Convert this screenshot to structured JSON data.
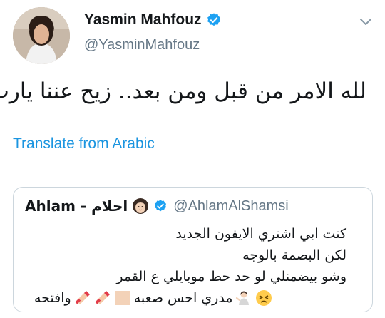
{
  "tweet": {
    "author": {
      "display_name": "Yasmin Mahfouz",
      "handle": "@YasminMahfouz",
      "verified": true,
      "avatar_icon": "profile-photo"
    },
    "text": "لله الامر من قبل ومن بعد.. زيح عننا يارب",
    "translate_label": "Translate from Arabic",
    "menu_icon": "chevron-down-icon"
  },
  "quoted_tweet": {
    "display_name": "Ahlam - احلام",
    "handle": "@AhlamAlShamsi",
    "verified": true,
    "lines": [
      "كنت ابي اشتري الايفون الجديد",
      "لكن البصمة بالوجه",
      "وشو بيضمنلي لو حد حط موبايلي ع القمر"
    ],
    "last_line_parts": [
      "وافتحه",
      "مدري احس صعبه"
    ]
  },
  "colors": {
    "link": "#1b95e0",
    "verified": "#1da1f2",
    "secondary_text": "#657786",
    "border": "#ccd6dd"
  }
}
